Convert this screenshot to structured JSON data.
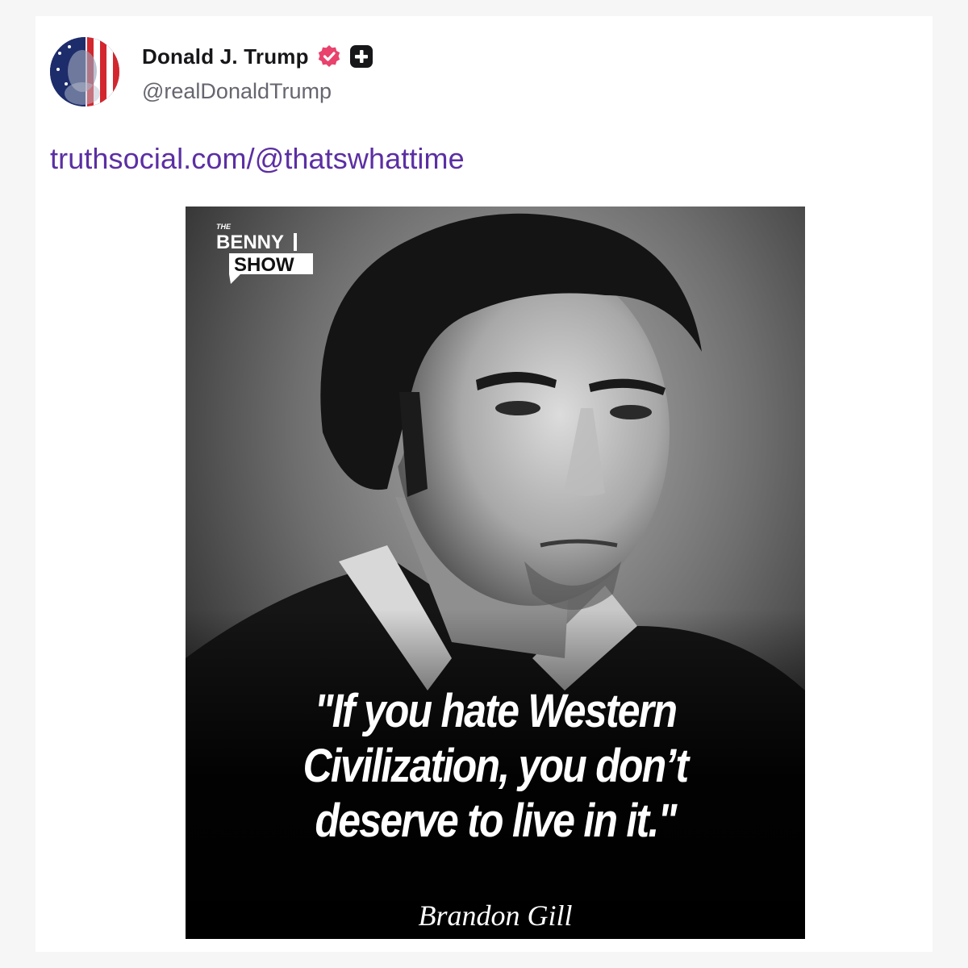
{
  "post": {
    "author": {
      "display_name": "Donald J. Trump",
      "handle": "@realDonaldTrump",
      "avatar_icon": "flag-avatar",
      "verified_icon": "verified-badge-icon",
      "plus_icon": "plus-badge-icon"
    },
    "link_text": "truthsocial.com/@thatswhattime",
    "colors": {
      "link": "#5b2fa3",
      "verified_badge": "#e8426d",
      "name": "#17171a",
      "handle": "#66666f"
    },
    "image": {
      "logo_top": "THE",
      "logo_line1": "BENNY",
      "logo_line2": "SHOW",
      "quote_lines": [
        "\"If you hate Western",
        "Civilization, you don’t",
        "deserve to live in it.\""
      ],
      "attribution": "Brandon Gill"
    }
  }
}
